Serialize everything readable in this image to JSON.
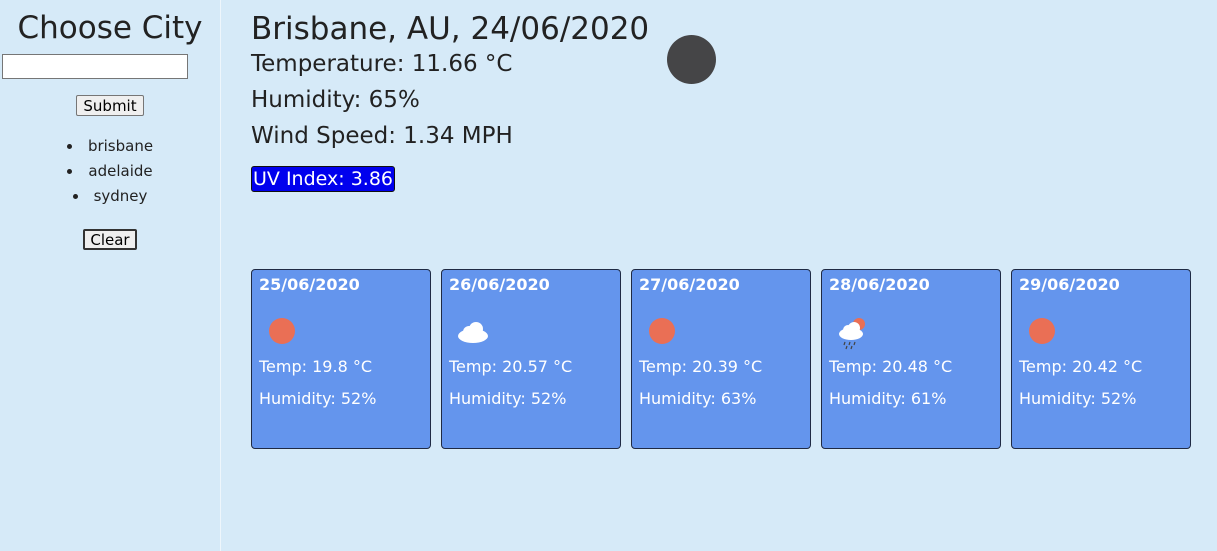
{
  "sidebar": {
    "title": "Choose City",
    "search_value": "",
    "submit_label": "Submit",
    "history": [
      "brisbane",
      "adelaide",
      "sydney"
    ],
    "clear_label": "Clear"
  },
  "current": {
    "title": "Brisbane, AU, 24/06/2020",
    "temperature": "Temperature: 11.66 °C",
    "humidity": "Humidity: 65%",
    "wind": "Wind Speed: 1.34 MPH",
    "uv": "UV Index: 3.86",
    "icon": "moon-icon"
  },
  "forecast": [
    {
      "date": "25/06/2020",
      "icon": "sun-icon",
      "temp": "Temp: 19.8 °C",
      "humidity": "Humidity: 52%"
    },
    {
      "date": "26/06/2020",
      "icon": "cloud-icon",
      "temp": "Temp: 20.57 °C",
      "humidity": "Humidity: 52%"
    },
    {
      "date": "27/06/2020",
      "icon": "sun-icon",
      "temp": "Temp: 20.39 °C",
      "humidity": "Humidity: 63%"
    },
    {
      "date": "28/06/2020",
      "icon": "rain-cloud-sun-icon",
      "temp": "Temp: 20.48 °C",
      "humidity": "Humidity: 61%"
    },
    {
      "date": "29/06/2020",
      "icon": "sun-icon",
      "temp": "Temp: 20.42 °C",
      "humidity": "Humidity: 52%"
    }
  ],
  "colors": {
    "background": "#d6eaf8",
    "card": "#6495ed",
    "uv_badge": "#0000ee",
    "sun": "#ea6f55"
  }
}
